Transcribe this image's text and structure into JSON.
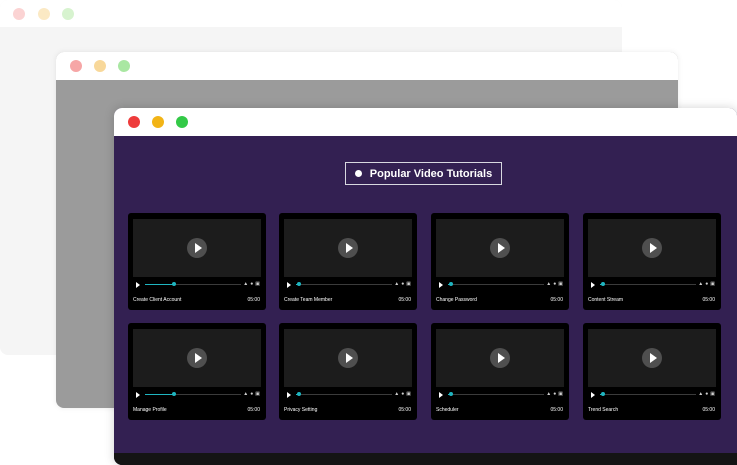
{
  "windows": {
    "back": {
      "dot_colors": [
        "#fbd3d3",
        "#fbe9c4",
        "#d7f3cf"
      ]
    },
    "middle": {
      "dot_colors": [
        "#f6a6a6",
        "#f8d89a",
        "#a9e7a2"
      ]
    },
    "front": {
      "dot_colors": [
        "#ee3b3b",
        "#f2b416",
        "#33c947"
      ]
    }
  },
  "colors": {
    "panel_background": "#332052",
    "accent_progress": "#1fb5c0",
    "card_background": "#000000"
  },
  "main": {
    "heading": "Popular Video Tutorials",
    "cards": [
      {
        "title": "Create Client Account",
        "duration": "05:00",
        "progress": 0.3
      },
      {
        "title": "Create Team Member",
        "duration": "05:00",
        "progress": 0.03
      },
      {
        "title": "Change Password",
        "duration": "05:00",
        "progress": 0.03
      },
      {
        "title": "Content Stream",
        "duration": "05:00",
        "progress": 0.03
      },
      {
        "title": "Manage Profile",
        "duration": "05:00",
        "progress": 0.3
      },
      {
        "title": "Privacy Setting",
        "duration": "05:00",
        "progress": 0.03
      },
      {
        "title": "Scheduler",
        "duration": "05:00",
        "progress": 0.03
      },
      {
        "title": "Trend Search",
        "duration": "05:00",
        "progress": 0.03
      }
    ],
    "player_icons": [
      "volume-icon",
      "settings-icon",
      "fullscreen-icon"
    ]
  }
}
